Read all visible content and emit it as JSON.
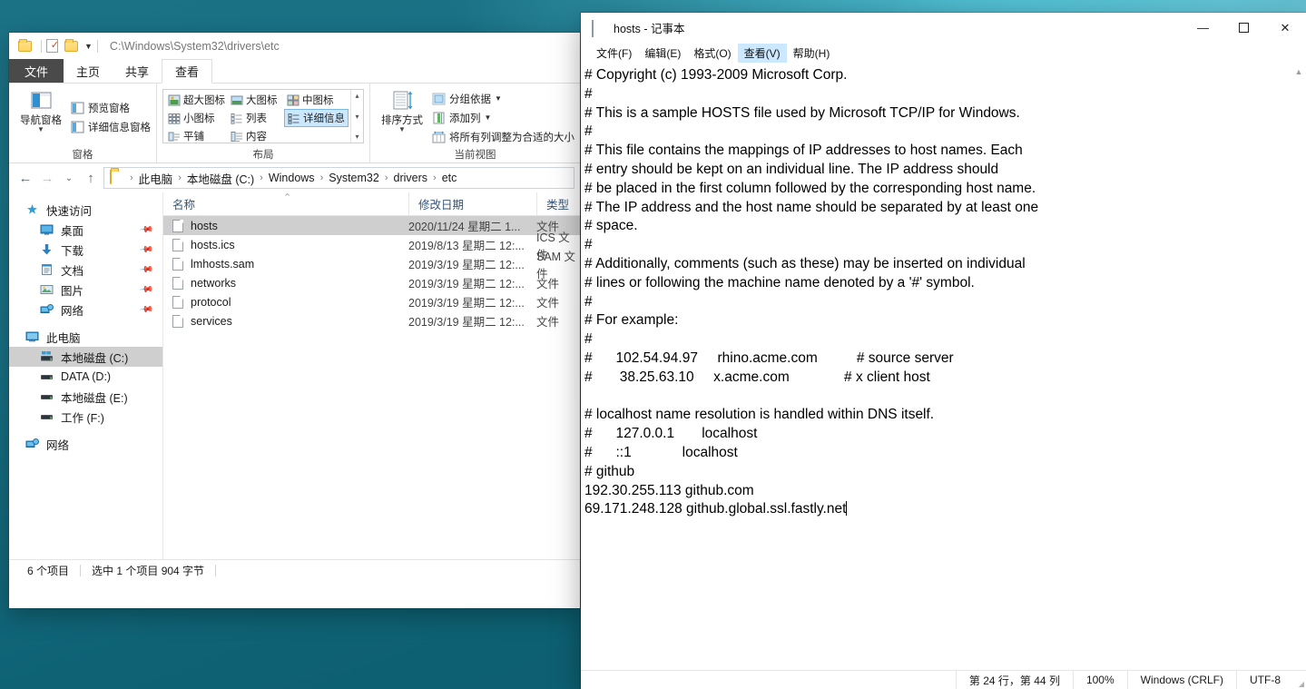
{
  "explorer": {
    "quick_access_toolbar": {
      "path": "C:\\Windows\\System32\\drivers\\etc",
      "items": [
        "folder-icon",
        "properties-icon",
        "new-folder-icon",
        "customize-caret"
      ]
    },
    "tabs": [
      {
        "label": "文件",
        "kind": "file"
      },
      {
        "label": "主页",
        "kind": "normal"
      },
      {
        "label": "共享",
        "kind": "normal"
      },
      {
        "label": "查看",
        "kind": "active"
      }
    ],
    "ribbon": {
      "groups": [
        {
          "title": "窗格",
          "big_button": {
            "label": "导航窗格",
            "has_dropdown": true
          },
          "small_buttons": [
            {
              "label": "预览窗格"
            },
            {
              "label": "详细信息窗格"
            }
          ]
        },
        {
          "title": "布局",
          "gallery": [
            {
              "label": "超大图标",
              "selected": false
            },
            {
              "label": "大图标",
              "selected": false
            },
            {
              "label": "中图标",
              "selected": false
            },
            {
              "label": "小图标",
              "selected": false
            },
            {
              "label": "列表",
              "selected": false
            },
            {
              "label": "详细信息",
              "selected": true
            },
            {
              "label": "平铺",
              "selected": false
            },
            {
              "label": "内容",
              "selected": false
            }
          ]
        },
        {
          "title": "当前视图",
          "big_button": {
            "label": "排序方式",
            "has_dropdown": true
          },
          "small_buttons": [
            {
              "label": "分组依据",
              "has_dropdown": true
            },
            {
              "label": "添加列",
              "has_dropdown": true
            },
            {
              "label": "将所有列调整为合适的大小"
            }
          ]
        }
      ]
    },
    "address_bar": {
      "back": "←",
      "forward": "→",
      "recent": "⌄",
      "up": "↑",
      "breadcrumbs": [
        "此电脑",
        "本地磁盘 (C:)",
        "Windows",
        "System32",
        "drivers",
        "etc"
      ]
    },
    "nav_pane": [
      {
        "label": "快速访问",
        "icon": "star-pin-icon",
        "level": 0,
        "pinned": false,
        "selected": false
      },
      {
        "label": "桌面",
        "icon": "desktop-icon",
        "level": 1,
        "pinned": true,
        "selected": false
      },
      {
        "label": "下载",
        "icon": "download-icon",
        "level": 1,
        "pinned": true,
        "selected": false
      },
      {
        "label": "文档",
        "icon": "documents-icon",
        "level": 1,
        "pinned": true,
        "selected": false
      },
      {
        "label": "图片",
        "icon": "pictures-icon",
        "level": 1,
        "pinned": true,
        "selected": false
      },
      {
        "label": "网络",
        "icon": "network-icon",
        "level": 1,
        "pinned": true,
        "selected": false
      },
      {
        "label": "此电脑",
        "icon": "this-pc-icon",
        "level": 0,
        "pinned": false,
        "selected": false
      },
      {
        "label": "本地磁盘 (C:)",
        "icon": "windows-drive-icon",
        "level": 1,
        "pinned": false,
        "selected": true
      },
      {
        "label": "DATA (D:)",
        "icon": "drive-icon",
        "level": 1,
        "pinned": false,
        "selected": false
      },
      {
        "label": "本地磁盘 (E:)",
        "icon": "drive-icon",
        "level": 1,
        "pinned": false,
        "selected": false
      },
      {
        "label": "工作 (F:)",
        "icon": "drive-icon",
        "level": 1,
        "pinned": false,
        "selected": false
      },
      {
        "label": "网络",
        "icon": "network-icon",
        "level": 0,
        "pinned": false,
        "selected": false
      }
    ],
    "file_list": {
      "columns": [
        "名称",
        "修改日期",
        "类型"
      ],
      "rows": [
        {
          "name": "hosts",
          "date": "2020/11/24 星期二 1...",
          "type": "文件",
          "selected": true
        },
        {
          "name": "hosts.ics",
          "date": "2019/8/13 星期二 12:...",
          "type": "ICS 文件",
          "selected": false
        },
        {
          "name": "lmhosts.sam",
          "date": "2019/3/19 星期二 12:...",
          "type": "SAM 文件",
          "selected": false
        },
        {
          "name": "networks",
          "date": "2019/3/19 星期二 12:...",
          "type": "文件",
          "selected": false
        },
        {
          "name": "protocol",
          "date": "2019/3/19 星期二 12:...",
          "type": "文件",
          "selected": false
        },
        {
          "name": "services",
          "date": "2019/3/19 星期二 12:...",
          "type": "文件",
          "selected": false
        }
      ]
    },
    "status_bar": {
      "count": "6 个项目",
      "selection": "选中 1 个项目  904 字节"
    }
  },
  "notepad": {
    "title": "hosts - 记事本",
    "window_controls": {
      "minimize": "—",
      "maximize": "❐",
      "close": "✕"
    },
    "menu": [
      {
        "label": "文件(F)",
        "active": false
      },
      {
        "label": "编辑(E)",
        "active": false
      },
      {
        "label": "格式(O)",
        "active": false
      },
      {
        "label": "查看(V)",
        "active": true
      },
      {
        "label": "帮助(H)",
        "active": false
      }
    ],
    "content": "# Copyright (c) 1993-2009 Microsoft Corp.\n#\n# This is a sample HOSTS file used by Microsoft TCP/IP for Windows.\n#\n# This file contains the mappings of IP addresses to host names. Each\n# entry should be kept on an individual line. The IP address should\n# be placed in the first column followed by the corresponding host name.\n# The IP address and the host name should be separated by at least one\n# space.\n#\n# Additionally, comments (such as these) may be inserted on individual\n# lines or following the machine name denoted by a '#' symbol.\n#\n# For example:\n#\n#      102.54.94.97     rhino.acme.com          # source server\n#       38.25.63.10     x.acme.com              # x client host\n\n# localhost name resolution is handled within DNS itself.\n#\t127.0.0.1       localhost\n#\t::1             localhost\n# github\n192.30.255.113 github.com\n69.171.248.128 github.global.ssl.fastly.net",
    "status_bar": {
      "position": "第 24 行，第 44 列",
      "zoom": "100%",
      "line_ending": "Windows (CRLF)",
      "encoding": "UTF-8"
    }
  }
}
